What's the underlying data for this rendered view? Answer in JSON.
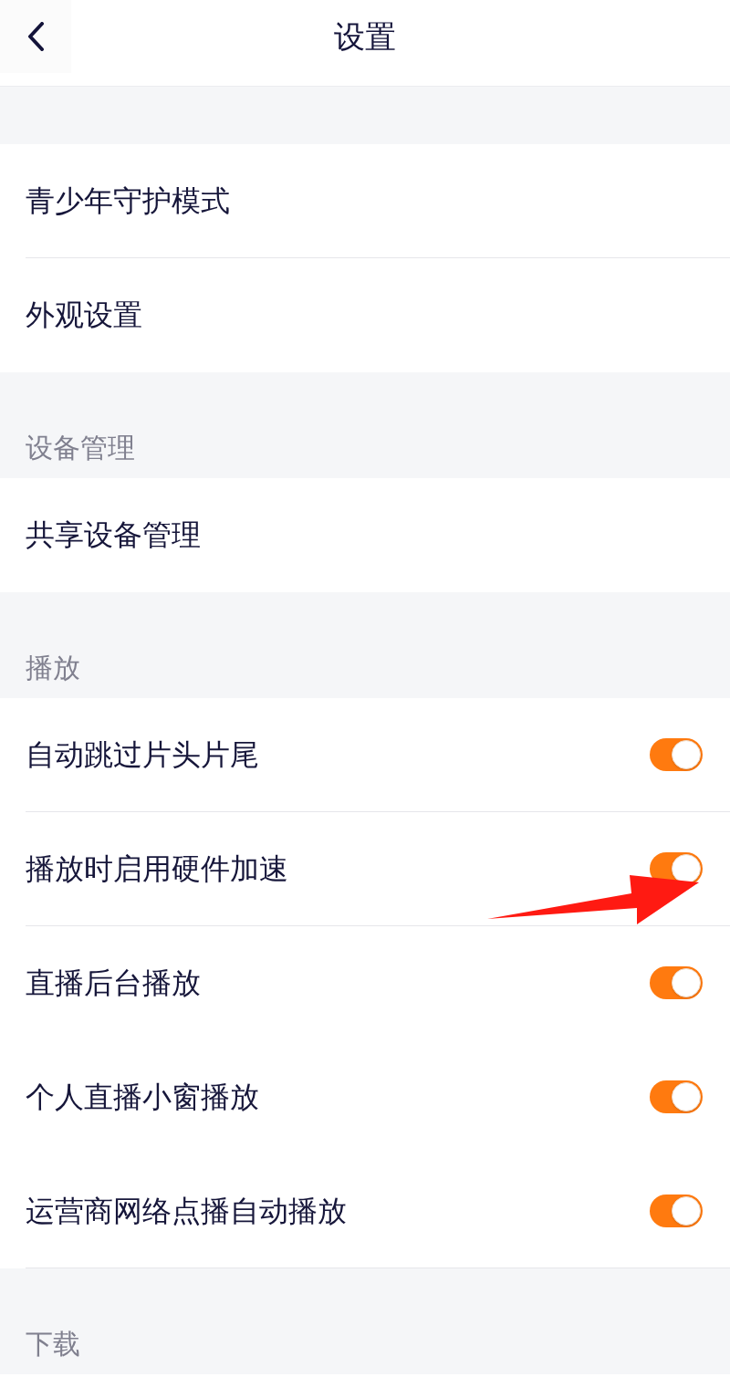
{
  "header": {
    "title": "设置"
  },
  "groups": [
    {
      "items": [
        {
          "kind": "link",
          "label": "青少年守护模式",
          "divider": true
        },
        {
          "kind": "link",
          "label": "外观设置",
          "divider": false
        }
      ]
    },
    {
      "heading": "设备管理",
      "items": [
        {
          "kind": "link",
          "label": "共享设备管理",
          "divider": false
        }
      ]
    },
    {
      "heading": "播放",
      "items": [
        {
          "kind": "toggle",
          "label": "自动跳过片头片尾",
          "on": true,
          "divider": true
        },
        {
          "kind": "toggle",
          "label": "播放时启用硬件加速",
          "on": true,
          "divider": true
        },
        {
          "kind": "toggle",
          "label": "直播后台播放",
          "on": true,
          "divider": false
        },
        {
          "kind": "toggle",
          "label": "个人直播小窗播放",
          "on": true,
          "divider": false
        },
        {
          "kind": "toggle",
          "label": "运营商网络点播自动播放",
          "on": true,
          "divider": true
        }
      ]
    },
    {
      "heading": "下载"
    }
  ]
}
